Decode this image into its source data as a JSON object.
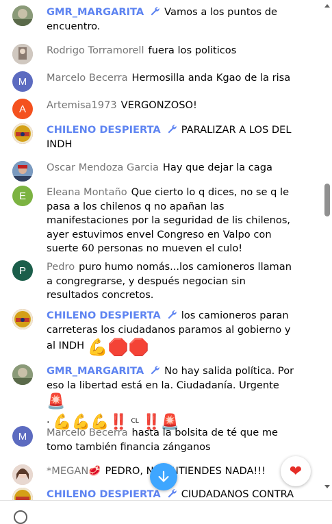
{
  "messages": [
    {
      "author": "GMR_MARGARITA",
      "owner": true,
      "text": "Vamos a los puntos de encuentro.",
      "avatar_letter": "",
      "avatar_color": "#7a8a6a"
    },
    {
      "author": "Rodrigo Torramorell",
      "owner": false,
      "text": "fuera los politicos",
      "avatar_letter": "",
      "avatar_color": "#b8aaa0"
    },
    {
      "author": "Marcelo Becerra",
      "owner": false,
      "text": "Hermosilla anda Kgao de la risa",
      "avatar_letter": "M",
      "avatar_color": "#5c6bc0"
    },
    {
      "author": "Artemisa1973",
      "owner": false,
      "text": "VERGONZOSO!",
      "avatar_letter": "A",
      "avatar_color": "#f4511e"
    },
    {
      "author": "CHILENO DESPIERTA",
      "owner": true,
      "text": "PARALIZAR A LOS DEL INDH",
      "avatar_letter": "",
      "avatar_color": "#c0392b"
    },
    {
      "author": "Oscar Mendoza Garcia",
      "owner": false,
      "text": "Hay que dejar la caga",
      "avatar_letter": "",
      "avatar_color": "#6a7fa0"
    },
    {
      "author": "Eleana Montaño",
      "owner": false,
      "text": "Que cierto lo q dices, no se q le pasa a los chilenos q no apañan las manifestaciones por la seguridad de lis chilenos, ayer estuvimos envel Congreso en Valpo con suerte 60 personas no mueven el culo!",
      "avatar_letter": "E",
      "avatar_color": "#7cb342"
    },
    {
      "author": "Pedro",
      "owner": false,
      "text": "puro humo nomás...los camioneros llaman a congregrarse, y después negocian sin resultados concretos.",
      "avatar_letter": "P",
      "avatar_color": "#1b5e4a"
    },
    {
      "author": "CHILENO DESPIERTA",
      "owner": true,
      "text": "los camioneros paran carreteras los ciudadanos paramos al gobierno y al INDH",
      "avatar_letter": "",
      "avatar_color": "#c0392b"
    },
    {
      "author": "GMR_MARGARITA",
      "owner": true,
      "text": "No hay salida política. Por eso la libertad está en la. Ciudadanía. Urgente",
      "avatar_letter": "",
      "avatar_color": "#7a8a6a"
    },
    {
      "author": "Marcelo Becerra",
      "owner": false,
      "text": "hasta la bolsita de té que me tomo también financia zánganos",
      "avatar_letter": "M",
      "avatar_color": "#5c6bc0"
    },
    {
      "author": "*MEGAN🥩",
      "owner": false,
      "text": "PEDRO, NO ENTIENDES NADA!!!",
      "avatar_letter": "",
      "avatar_color": "#d8c0b0"
    },
    {
      "author": "CHILENO DESPIERTA",
      "owner": true,
      "text": "CIUDADANOS CONTRA",
      "avatar_letter": "",
      "avatar_color": "#c0392b"
    }
  ],
  "emoji_lines": {
    "m8": "💪🛑🛑",
    "m9_pre": ".",
    "m9": "💪💪💪‼️",
    "m9_cl": "CL",
    "m9_post": "‼️🚨",
    "m9_siren": "🚨"
  },
  "controls": {
    "jump_icon": "arrow-down",
    "heart": "❤"
  }
}
